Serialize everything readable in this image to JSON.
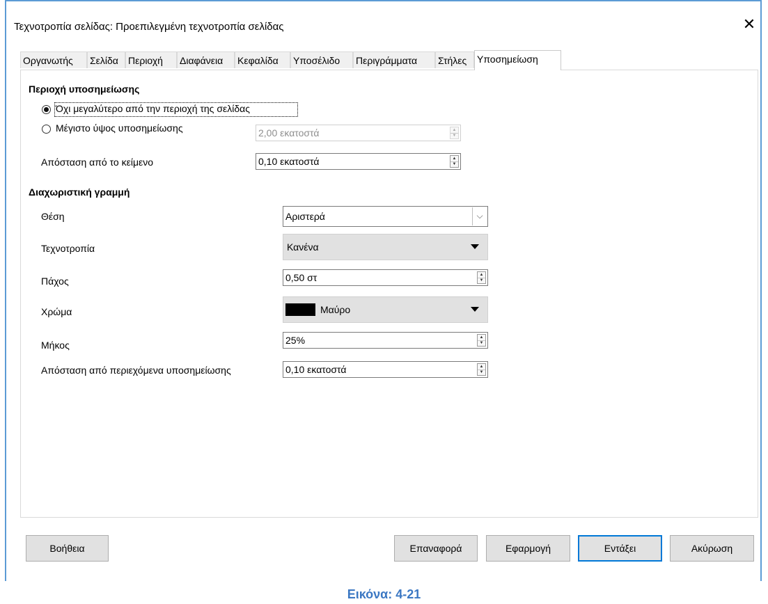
{
  "dialog": {
    "title": "Τεχνοτροπία σελίδας: Προεπιλεγμένη τεχνοτροπία σελίδας",
    "close_symbol": "✕"
  },
  "tabs": [
    {
      "label": "Οργανωτής",
      "active": false
    },
    {
      "label": "Σελίδα",
      "active": false
    },
    {
      "label": "Περιοχή",
      "active": false
    },
    {
      "label": "Διαφάνεια",
      "active": false
    },
    {
      "label": "Κεφαλίδα",
      "active": false
    },
    {
      "label": "Υποσέλιδο",
      "active": false
    },
    {
      "label": "Περιγράμματα",
      "active": false
    },
    {
      "label": "Στήλες",
      "active": false
    },
    {
      "label": "Υποσημείωση",
      "active": true
    }
  ],
  "footnote_area": {
    "heading": "Περιοχή υποσημείωσης",
    "option_not_larger": "Όχι μεγαλύτερο από την περιοχή της σελίδας",
    "option_not_larger_selected": true,
    "option_max_height": "Μέγιστο ύψος υποσημείωσης",
    "max_height_value": "2,00 εκατοστά",
    "spacing_label": "Απόσταση από το κείμενο",
    "spacing_value": "0,10 εκατοστά"
  },
  "separator_line": {
    "heading": "Διαχωριστική γραμμή",
    "position_label": "Θέση",
    "position_value": "Αριστερά",
    "style_label": "Τεχνοτροπία",
    "style_value": "Κανένα",
    "thickness_label": "Πάχος",
    "thickness_value": "0,50 στ",
    "color_label": "Χρώμα",
    "color_value": "Μαύρο",
    "color_hex": "#000000",
    "length_label": "Μήκος",
    "length_value": "25%",
    "spacing_contents_label": "Απόσταση από περιεχόμενα υποσημείωσης",
    "spacing_contents_value": "0,10 εκατοστά"
  },
  "buttons": {
    "help": "Βοήθεια",
    "reset": "Επαναφορά",
    "apply": "Εφαρμογή",
    "ok": "Εντάξει",
    "cancel": "Ακύρωση"
  },
  "caption": "Εικόνα: 4-21",
  "colors": {
    "accent": "#0078d7",
    "frame": "#5b9bd5",
    "caption": "#3c78c3"
  }
}
